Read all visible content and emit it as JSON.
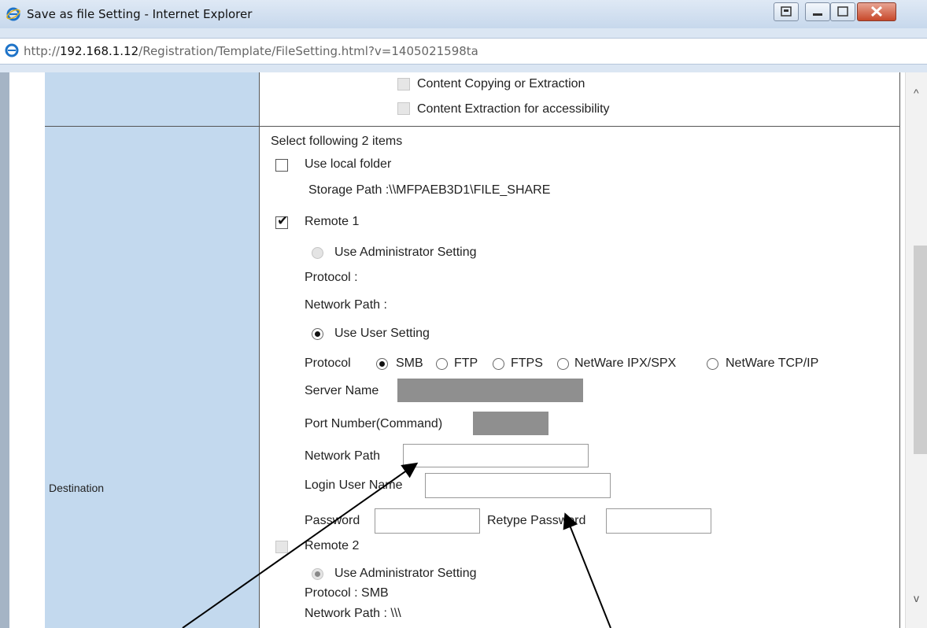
{
  "window": {
    "title": "Save as file Setting - Internet Explorer",
    "url_prefix": "http://",
    "url_host": "192.168.1.12",
    "url_path": "/Registration/Template/FileSetting.html?v=1405021598ta"
  },
  "permissions": {
    "content_copying": "Content Copying or Extraction",
    "content_extraction": "Content Extraction for accessibility"
  },
  "destination": {
    "label": "Destination",
    "select_hint": "Select following 2 items",
    "use_local_folder": "Use local folder",
    "storage_path": "Storage Path :\\\\MFPAEB3D1\\FILE_SHARE",
    "remote1": {
      "label": "Remote 1",
      "checked": true,
      "use_admin_setting": "Use Administrator Setting",
      "protocol_label": "Protocol :",
      "network_path_label": "Network Path :",
      "use_user_setting": "Use User Setting",
      "protocol_field_label": "Protocol",
      "protocol_options": [
        "SMB",
        "FTP",
        "FTPS",
        "NetWare IPX/SPX",
        "NetWare TCP/IP"
      ],
      "selected_protocol": "SMB",
      "server_name_label": "Server Name",
      "port_label": "Port Number(Command)",
      "network_path_field_label": "Network Path",
      "network_path_value": "",
      "login_user_label": "Login User Name",
      "login_user_value": "",
      "password_label": "Password",
      "retype_password_label": "Retype Password"
    },
    "remote2": {
      "label": "Remote 2",
      "use_admin_setting": "Use Administrator Setting",
      "protocol_text": "Protocol : SMB",
      "network_path_text": "Network Path : \\\\\\"
    }
  },
  "colors": {
    "label_bg": "#c3d9ee",
    "titlebar": "#d4e1f0"
  }
}
